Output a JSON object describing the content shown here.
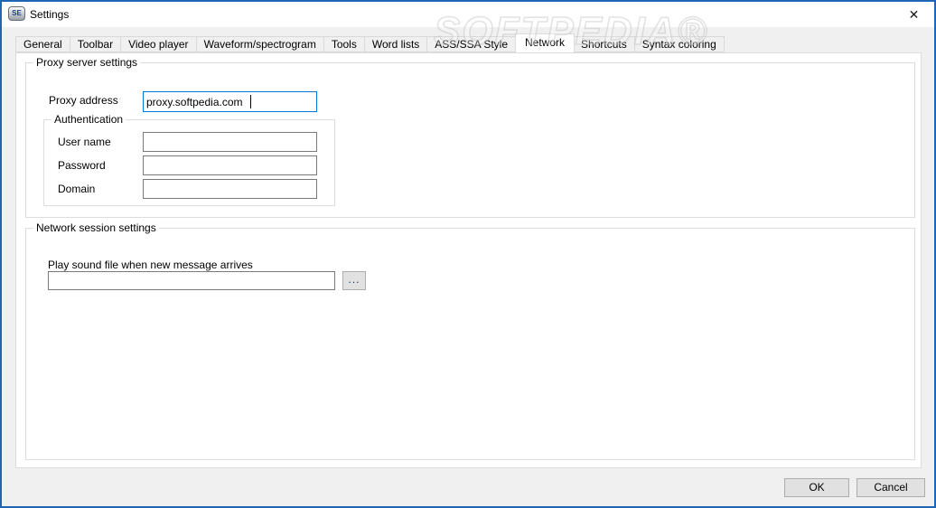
{
  "window": {
    "title": "Settings",
    "icon_text": "SE",
    "close_glyph": "✕"
  },
  "watermark": "SOFTPEDIA®",
  "tabs": [
    "General",
    "Toolbar",
    "Video player",
    "Waveform/spectrogram",
    "Tools",
    "Word lists",
    "ASS/SSA Style",
    "Network",
    "Shortcuts",
    "Syntax coloring"
  ],
  "selected_tab": "Network",
  "network_page": {
    "proxy_group": {
      "title": "Proxy server settings",
      "proxy_address": {
        "label": "Proxy address",
        "value": "proxy.softpedia.com"
      },
      "auth_group": {
        "title": "Authentication",
        "fields": [
          {
            "label": "User name",
            "value": ""
          },
          {
            "label": "Password",
            "value": ""
          },
          {
            "label": "Domain",
            "value": ""
          }
        ]
      }
    },
    "session_group": {
      "title": "Network session settings",
      "sound_file": {
        "label": "Play sound file when new message arrives",
        "value": "",
        "browse_label": "..."
      }
    }
  },
  "footer": {
    "ok_label": "OK",
    "cancel_label": "Cancel"
  },
  "colors": {
    "window_border": "#2065b4",
    "dialog_bg": "#f0f0f0",
    "panel_bg": "#ffffff",
    "focus_border": "#0078d7",
    "button_bg": "#e1e1e1"
  }
}
